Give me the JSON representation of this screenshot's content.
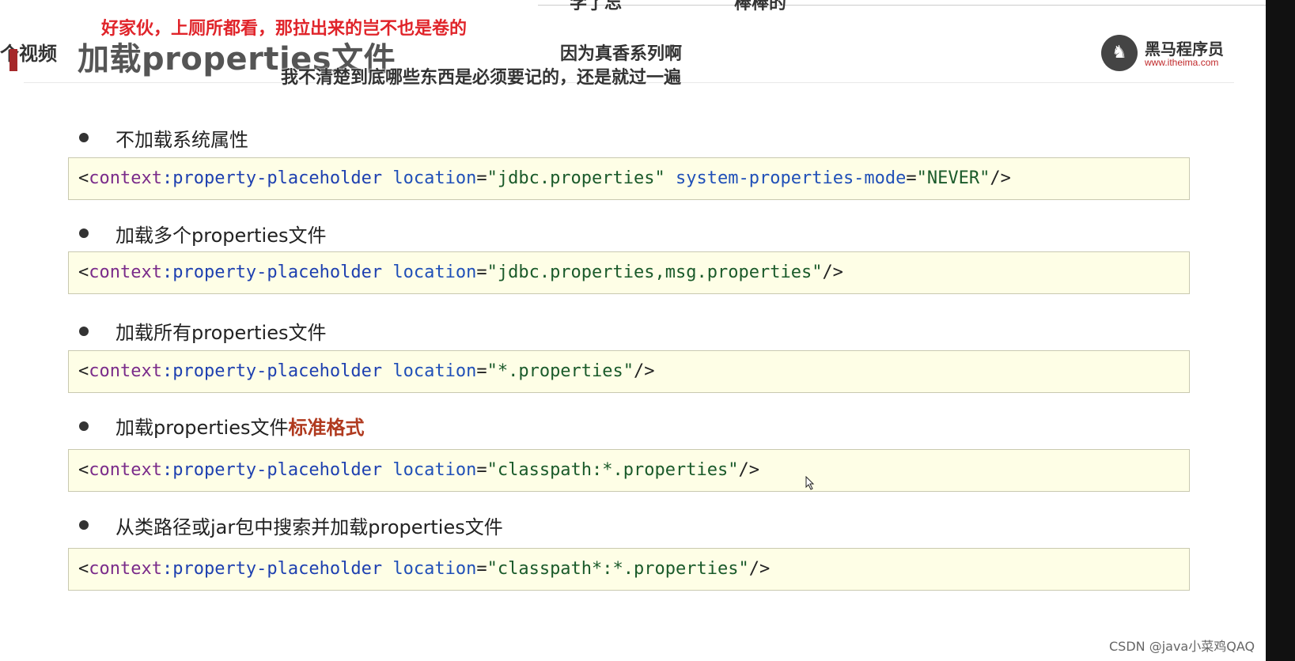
{
  "slide": {
    "title": "加载properties文件",
    "left_cut_text": "个视频"
  },
  "logo": {
    "icon": "itheima-horse-icon",
    "name": "黑马程序员",
    "url": "www.itheima.com"
  },
  "danmaku": {
    "red": "好家伙，上厕所都看，那拉出来的岂不也是卷的",
    "line1": "因为真香系列啊",
    "line2": "我不清楚到底哪些东西是必须要记的，还是就过一遍",
    "top1": "学了忘",
    "top2": "棒棒的"
  },
  "items": [
    {
      "label": "不加载系统属性",
      "highlight": "",
      "code": {
        "open": "<",
        "tag": "context",
        "colon": ":",
        "name": "property-placeholder",
        "attr1": "location",
        "val1": "\"jdbc.properties\"",
        "attr2": "system-properties-mode",
        "val2": "\"NEVER\"",
        "close": "/>"
      }
    },
    {
      "label": "加载多个properties文件",
      "highlight": "",
      "code": {
        "open": "<",
        "tag": "context",
        "colon": ":",
        "name": "property-placeholder",
        "attr1": "location",
        "val1": "\"jdbc.properties,msg.properties\"",
        "close": "/>"
      }
    },
    {
      "label": "加载所有properties文件",
      "highlight": "",
      "code": {
        "open": "<",
        "tag": "context",
        "colon": ":",
        "name": "property-placeholder",
        "attr1": "location",
        "val1": "\"*.properties\"",
        "close": "/>"
      }
    },
    {
      "label": "加载properties文件",
      "highlight": "标准格式",
      "code": {
        "open": "<",
        "tag": "context",
        "colon": ":",
        "name": "property-placeholder",
        "attr1": "location",
        "val1": "\"classpath:*.properties\"",
        "close": "/>"
      }
    },
    {
      "label": "从类路径或jar包中搜索并加载properties文件",
      "highlight": "",
      "code": {
        "open": "<",
        "tag": "context",
        "colon": ":",
        "name": "property-placeholder",
        "attr1": "location",
        "val1": "\"classpath*:*.properties\"",
        "close": "/>"
      }
    }
  ],
  "watermark": "CSDN @java小菜鸡QAQ",
  "colors": {
    "code_background": "#fefee6",
    "tag": "#7a2b8a",
    "attribute": "#2050b8",
    "value": "#1a5a2a",
    "highlight": "#b03a1f",
    "danmaku_red": "#e0242a"
  }
}
